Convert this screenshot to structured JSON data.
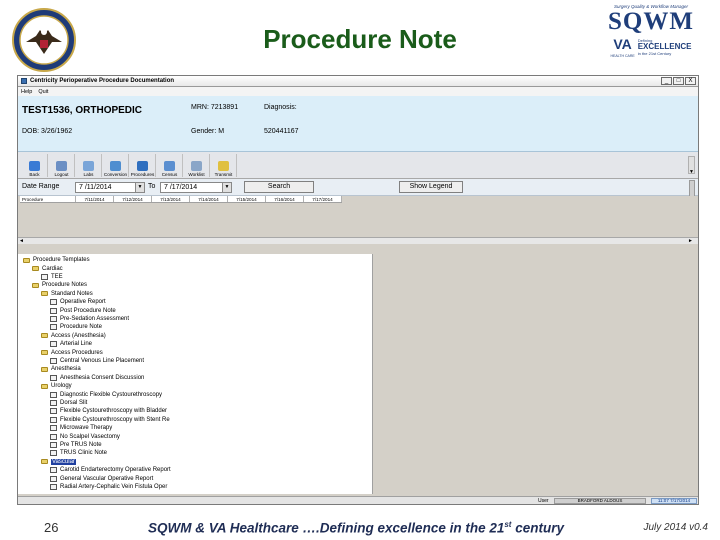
{
  "slide": {
    "title": "Procedure Note",
    "page_number": "26",
    "footer_before_sup": "SQWM & VA Healthcare ….Defining excellence in the 21",
    "footer_sup": "st",
    "footer_after_sup": " century",
    "footer_date": "July 2014 v0.4"
  },
  "logo": {
    "tagline": "Surgery Quality & Workflow Manager",
    "name": "SQWM",
    "va": "VA",
    "va_sub": "HEALTH CARE",
    "defining": "Defining",
    "excellence": "EXCELLENCE",
    "century": "in the 21st Century"
  },
  "app": {
    "window_title": "Centricity Perioperative Procedure Documentation",
    "window_buttons": [
      "_",
      "□",
      "X"
    ],
    "menu": [
      "Help",
      "Quit"
    ],
    "patient": {
      "name": "TEST1536, ORTHOPEDIC",
      "dob": "DOB: 3/26/1962",
      "mrn": "MRN: 7213891",
      "gender": "Gender: M",
      "diagnosis": "Diagnosis:",
      "id": "520441167"
    },
    "toolbar": [
      {
        "label": "Back",
        "icon": "back-arrow-icon",
        "color": "#3a7bd5"
      },
      {
        "label": "Logout",
        "icon": "logout-icon",
        "color": "#6b8fc4"
      },
      {
        "label": "Labs",
        "icon": "labs-icon",
        "color": "#7aa5d8"
      },
      {
        "label": "Conversion",
        "icon": "conversion-icon",
        "color": "#4f8ed0"
      },
      {
        "label": "Procedures",
        "icon": "procedures-icon",
        "color": "#2f6fbf"
      },
      {
        "label": "Census",
        "icon": "census-icon",
        "color": "#5b8fd0"
      },
      {
        "label": "Worklist",
        "icon": "worklist-icon",
        "color": "#8aa6c8"
      },
      {
        "label": "Transmit",
        "icon": "transmit-icon",
        "color": "#e0c040"
      }
    ],
    "date_range": {
      "label": "Date Range",
      "from": "7 /11/2014",
      "to_label": "To",
      "to": "7 /17/2014",
      "search": "Search",
      "legend": "Show Legend"
    },
    "calendar_columns": [
      "Procedure",
      "7/11/2014",
      "7/12/2014",
      "7/13/2014",
      "7/14/2014",
      "7/15/2014",
      "7/16/2014",
      "7/17/2014"
    ],
    "tree": [
      {
        "label": "Procedure Templates",
        "level": 0,
        "type": "folder"
      },
      {
        "label": "Cardiac",
        "level": 1,
        "type": "folder"
      },
      {
        "label": "TEE",
        "level": 2,
        "type": "doc"
      },
      {
        "label": "Procedure Notes",
        "level": 1,
        "type": "folder"
      },
      {
        "label": "Standard Notes",
        "level": 2,
        "type": "folder"
      },
      {
        "label": "Operative Report",
        "level": 3,
        "type": "doc"
      },
      {
        "label": "Post Procedure Note",
        "level": 3,
        "type": "doc"
      },
      {
        "label": "Pre-Sedation Assessment",
        "level": 3,
        "type": "doc"
      },
      {
        "label": "Procedure Note",
        "level": 3,
        "type": "doc"
      },
      {
        "label": "Access (Anesthesia)",
        "level": 2,
        "type": "folder"
      },
      {
        "label": "Arterial Line",
        "level": 3,
        "type": "doc"
      },
      {
        "label": "Access Procedures",
        "level": 2,
        "type": "folder"
      },
      {
        "label": "Central Venous Line Placement",
        "level": 3,
        "type": "doc"
      },
      {
        "label": "Anesthesia",
        "level": 2,
        "type": "folder"
      },
      {
        "label": "Anesthesia Consent Discussion",
        "level": 3,
        "type": "doc"
      },
      {
        "label": "Urology",
        "level": 2,
        "type": "folder"
      },
      {
        "label": "Diagnostic Flexible Cystourethroscopy",
        "level": 3,
        "type": "doc"
      },
      {
        "label": "Dorsal Slit",
        "level": 3,
        "type": "doc"
      },
      {
        "label": "Flexible Cystourethroscopy with Bladder",
        "level": 3,
        "type": "doc"
      },
      {
        "label": "Flexible Cystourethroscopy with Stent Re",
        "level": 3,
        "type": "doc"
      },
      {
        "label": "Microwave Therapy",
        "level": 3,
        "type": "doc"
      },
      {
        "label": "No Scalpel Vasectomy",
        "level": 3,
        "type": "doc"
      },
      {
        "label": "Pre TRUS Note",
        "level": 3,
        "type": "doc"
      },
      {
        "label": "TRUS Clinic Note",
        "level": 3,
        "type": "doc"
      },
      {
        "label": "Vascular",
        "level": 2,
        "type": "folder",
        "selected": true
      },
      {
        "label": "Carotid Endarterectomy Operative Report",
        "level": 3,
        "type": "doc"
      },
      {
        "label": "General Vascular Operative Report",
        "level": 3,
        "type": "doc"
      },
      {
        "label": "Radial Artery-Cephalic Vein Fistula Oper",
        "level": 3,
        "type": "doc"
      }
    ],
    "status": {
      "user_label": "User",
      "user_name": "BRADFORD ALDOUS",
      "time": "11:07 7/17/2014"
    }
  }
}
